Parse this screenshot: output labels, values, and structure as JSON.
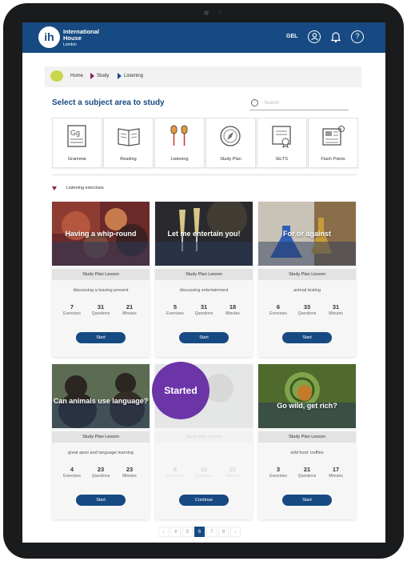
{
  "header": {
    "logo_mark": "ih",
    "brand_line1": "International",
    "brand_line2": "House",
    "brand_line3": "London",
    "language": "GEL"
  },
  "breadcrumb": {
    "items": [
      "Home",
      "Study",
      "Listening"
    ]
  },
  "main": {
    "heading": "Select a subject area to study",
    "search_placeholder": "Search"
  },
  "subjects": [
    {
      "label": "Grammar",
      "icon": "grammar-icon"
    },
    {
      "label": "Reading",
      "icon": "book-icon"
    },
    {
      "label": "Listening",
      "icon": "earphones-icon"
    },
    {
      "label": "Study Plan",
      "icon": "compass-icon"
    },
    {
      "label": "IELTS",
      "icon": "certificate-icon"
    },
    {
      "label": "Flash Points",
      "icon": "newspaper-icon"
    }
  ],
  "section_label": "Listening exercises",
  "stat_units": {
    "exercises": "Exercises",
    "questions": "Questions",
    "minutes": "Minutes"
  },
  "cards": [
    {
      "title": "Having a whip-round",
      "band": "Study Plan Lesson",
      "desc": "discussing a leaving present",
      "exercises": "7",
      "questions": "31",
      "minutes": "21",
      "button": "Start"
    },
    {
      "title": "Let me entertain you!",
      "band": "Study Plan Lesson",
      "desc": "discussing entertainment",
      "exercises": "5",
      "questions": "31",
      "minutes": "18",
      "button": "Start"
    },
    {
      "title": "For or against",
      "band": "Study Plan Lesson",
      "desc": "animal testing",
      "exercises": "6",
      "questions": "33",
      "minutes": "31",
      "button": "Start"
    },
    {
      "title": "Can animals use language?",
      "band": "Study Plan Lesson",
      "desc": "great apes and language learning",
      "exercises": "4",
      "questions": "23",
      "minutes": "23",
      "button": "Start"
    },
    {
      "title": "",
      "band": "Study Plan Lesson",
      "desc": "",
      "exercises": "8",
      "questions": "10",
      "minutes": "21",
      "button": "Continue",
      "overlay": "Started"
    },
    {
      "title": "Go wild, get rich?",
      "band": "Study Plan Lesson",
      "desc": "wild food: truffles",
      "exercises": "3",
      "questions": "21",
      "minutes": "17",
      "button": "Start"
    }
  ],
  "pagination": {
    "pages": [
      "‹",
      "4",
      "5",
      "6",
      "7",
      "8",
      "›"
    ],
    "current": "6"
  },
  "colors": {
    "brand_blue": "#174a82",
    "accent_purple": "#6b35a8",
    "breadcrumb_arrow": "#8a1f5a"
  }
}
